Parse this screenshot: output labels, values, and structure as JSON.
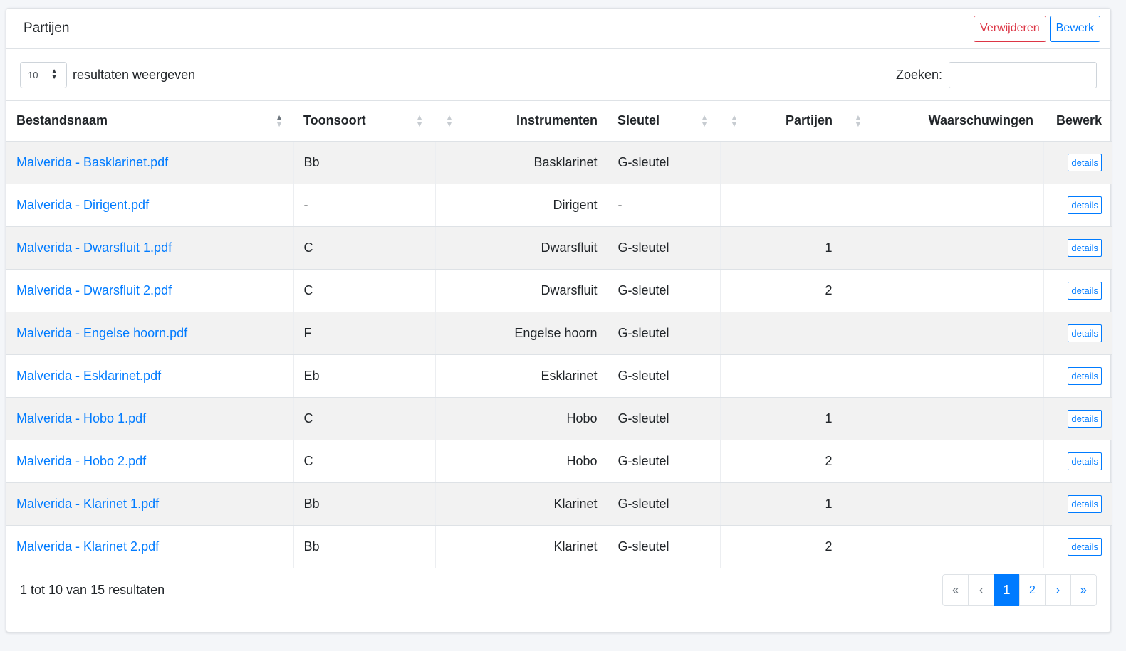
{
  "header": {
    "title": "Partijen",
    "delete_label": "Verwijderen",
    "edit_label": "Bewerk"
  },
  "toolbar": {
    "length_value": "10",
    "length_label": "resultaten weergeven",
    "search_label": "Zoeken:",
    "search_value": ""
  },
  "table": {
    "columns": {
      "bestandsnaam": "Bestandsnaam",
      "toonsoort": "Toonsoort",
      "instrumenten": "Instrumenten",
      "sleutel": "Sleutel",
      "partijen": "Partijen",
      "waarschuwingen": "Waarschuwingen",
      "bewerk": "Bewerk"
    },
    "details_label": "details",
    "rows": [
      {
        "file": "Malverida - Basklarinet.pdf",
        "key": "Bb",
        "instrument": "Basklarinet",
        "clef": "G-sleutel",
        "part": "",
        "warning": ""
      },
      {
        "file": "Malverida - Dirigent.pdf",
        "key": "-",
        "instrument": "Dirigent",
        "clef": "-",
        "part": "",
        "warning": ""
      },
      {
        "file": "Malverida - Dwarsfluit 1.pdf",
        "key": "C",
        "instrument": "Dwarsfluit",
        "clef": "G-sleutel",
        "part": "1",
        "warning": ""
      },
      {
        "file": "Malverida - Dwarsfluit 2.pdf",
        "key": "C",
        "instrument": "Dwarsfluit",
        "clef": "G-sleutel",
        "part": "2",
        "warning": ""
      },
      {
        "file": "Malverida - Engelse hoorn.pdf",
        "key": "F",
        "instrument": "Engelse hoorn",
        "clef": "G-sleutel",
        "part": "",
        "warning": ""
      },
      {
        "file": "Malverida - Esklarinet.pdf",
        "key": "Eb",
        "instrument": "Esklarinet",
        "clef": "G-sleutel",
        "part": "",
        "warning": ""
      },
      {
        "file": "Malverida - Hobo 1.pdf",
        "key": "C",
        "instrument": "Hobo",
        "clef": "G-sleutel",
        "part": "1",
        "warning": ""
      },
      {
        "file": "Malverida - Hobo 2.pdf",
        "key": "C",
        "instrument": "Hobo",
        "clef": "G-sleutel",
        "part": "2",
        "warning": ""
      },
      {
        "file": "Malverida - Klarinet 1.pdf",
        "key": "Bb",
        "instrument": "Klarinet",
        "clef": "G-sleutel",
        "part": "1",
        "warning": ""
      },
      {
        "file": "Malverida - Klarinet 2.pdf",
        "key": "Bb",
        "instrument": "Klarinet",
        "clef": "G-sleutel",
        "part": "2",
        "warning": ""
      }
    ]
  },
  "footer": {
    "info": "1 tot 10 van 15 resultaten",
    "pagination": {
      "first": "«",
      "prev": "‹",
      "pages": [
        "1",
        "2"
      ],
      "next": "›",
      "last": "»"
    }
  },
  "icons": {
    "sort": "sort-icon",
    "sort_asc": "sort-asc-icon",
    "select_caret": "select-caret-icon"
  },
  "colors": {
    "primary": "#007bff",
    "danger": "#dc3545",
    "stripe": "#f2f2f2"
  }
}
